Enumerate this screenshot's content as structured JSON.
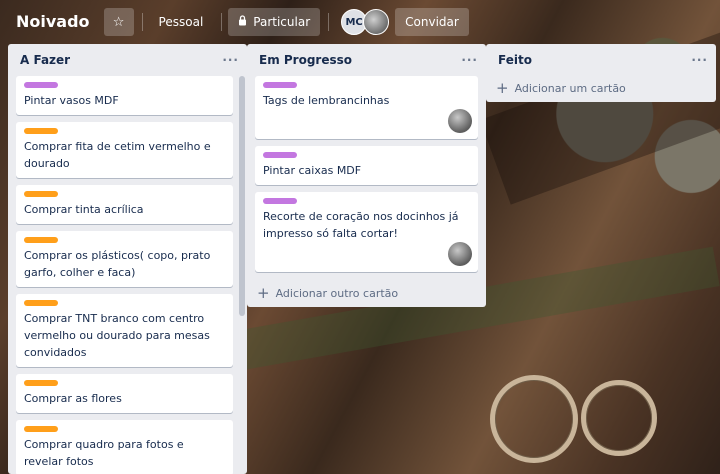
{
  "header": {
    "board_title": "Noivado",
    "star_icon": "star-icon",
    "workspace_label": "Pessoal",
    "visibility_label": "Particular",
    "visibility_icon": "lock-icon",
    "member_initials": "MC",
    "invite_label": "Convidar"
  },
  "colors": {
    "label_purple": "#c377e0",
    "label_orange": "#ff9f1a",
    "list_bg": "#ebecf0"
  },
  "lists": [
    {
      "title": "A Fazer",
      "cards": [
        {
          "label": "purple",
          "title": "Pintar vasos MDF"
        },
        {
          "label": "orange",
          "title": "Comprar fita de cetim vermelho e dourado"
        },
        {
          "label": "orange",
          "title": "Comprar tinta acrílica"
        },
        {
          "label": "orange",
          "title": "Comprar os plásticos( copo, prato garfo, colher e faca)"
        },
        {
          "label": "orange",
          "title": "Comprar TNT branco com centro vermelho ou dourado para mesas convidados"
        },
        {
          "label": "orange",
          "title": "Comprar as flores"
        },
        {
          "label": "orange",
          "title": "Comprar quadro para fotos e revelar fotos"
        }
      ]
    },
    {
      "title": "Em Progresso",
      "cards": [
        {
          "label": "purple",
          "title": "Tags de lembrancinhas",
          "member": true
        },
        {
          "label": "purple",
          "title": "Pintar caixas MDF"
        },
        {
          "label": "purple",
          "title": "Recorte de coração nos docinhos já impresso só falta cortar!",
          "member": true
        }
      ],
      "add_label": "Adicionar outro cartão"
    },
    {
      "title": "Feito",
      "cards": [],
      "add_label": "Adicionar um cartão"
    }
  ],
  "list_menu_icon": "more-horizontal-icon"
}
